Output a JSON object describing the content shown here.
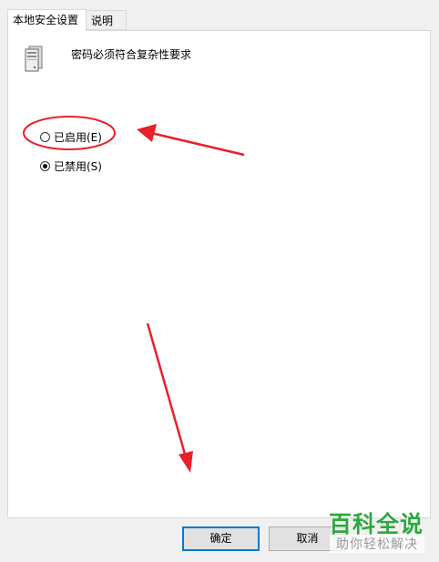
{
  "tabs": [
    {
      "label": "本地安全设置"
    },
    {
      "label": "说明"
    }
  ],
  "policy": {
    "title": "密码必须符合复杂性要求",
    "icon": "server-policy-icon"
  },
  "options": [
    {
      "label": "已启用(E)",
      "selected": false
    },
    {
      "label": "已禁用(S)",
      "selected": true
    }
  ],
  "buttons": {
    "ok_label": "确定",
    "cancel_label": "取消"
  },
  "watermark": {
    "main": "百科全说",
    "sub": "助你轻松解决"
  },
  "colors": {
    "annotation": "#e8202a",
    "focus_border": "#0078d7",
    "watermark_green": "#2ea83f"
  }
}
